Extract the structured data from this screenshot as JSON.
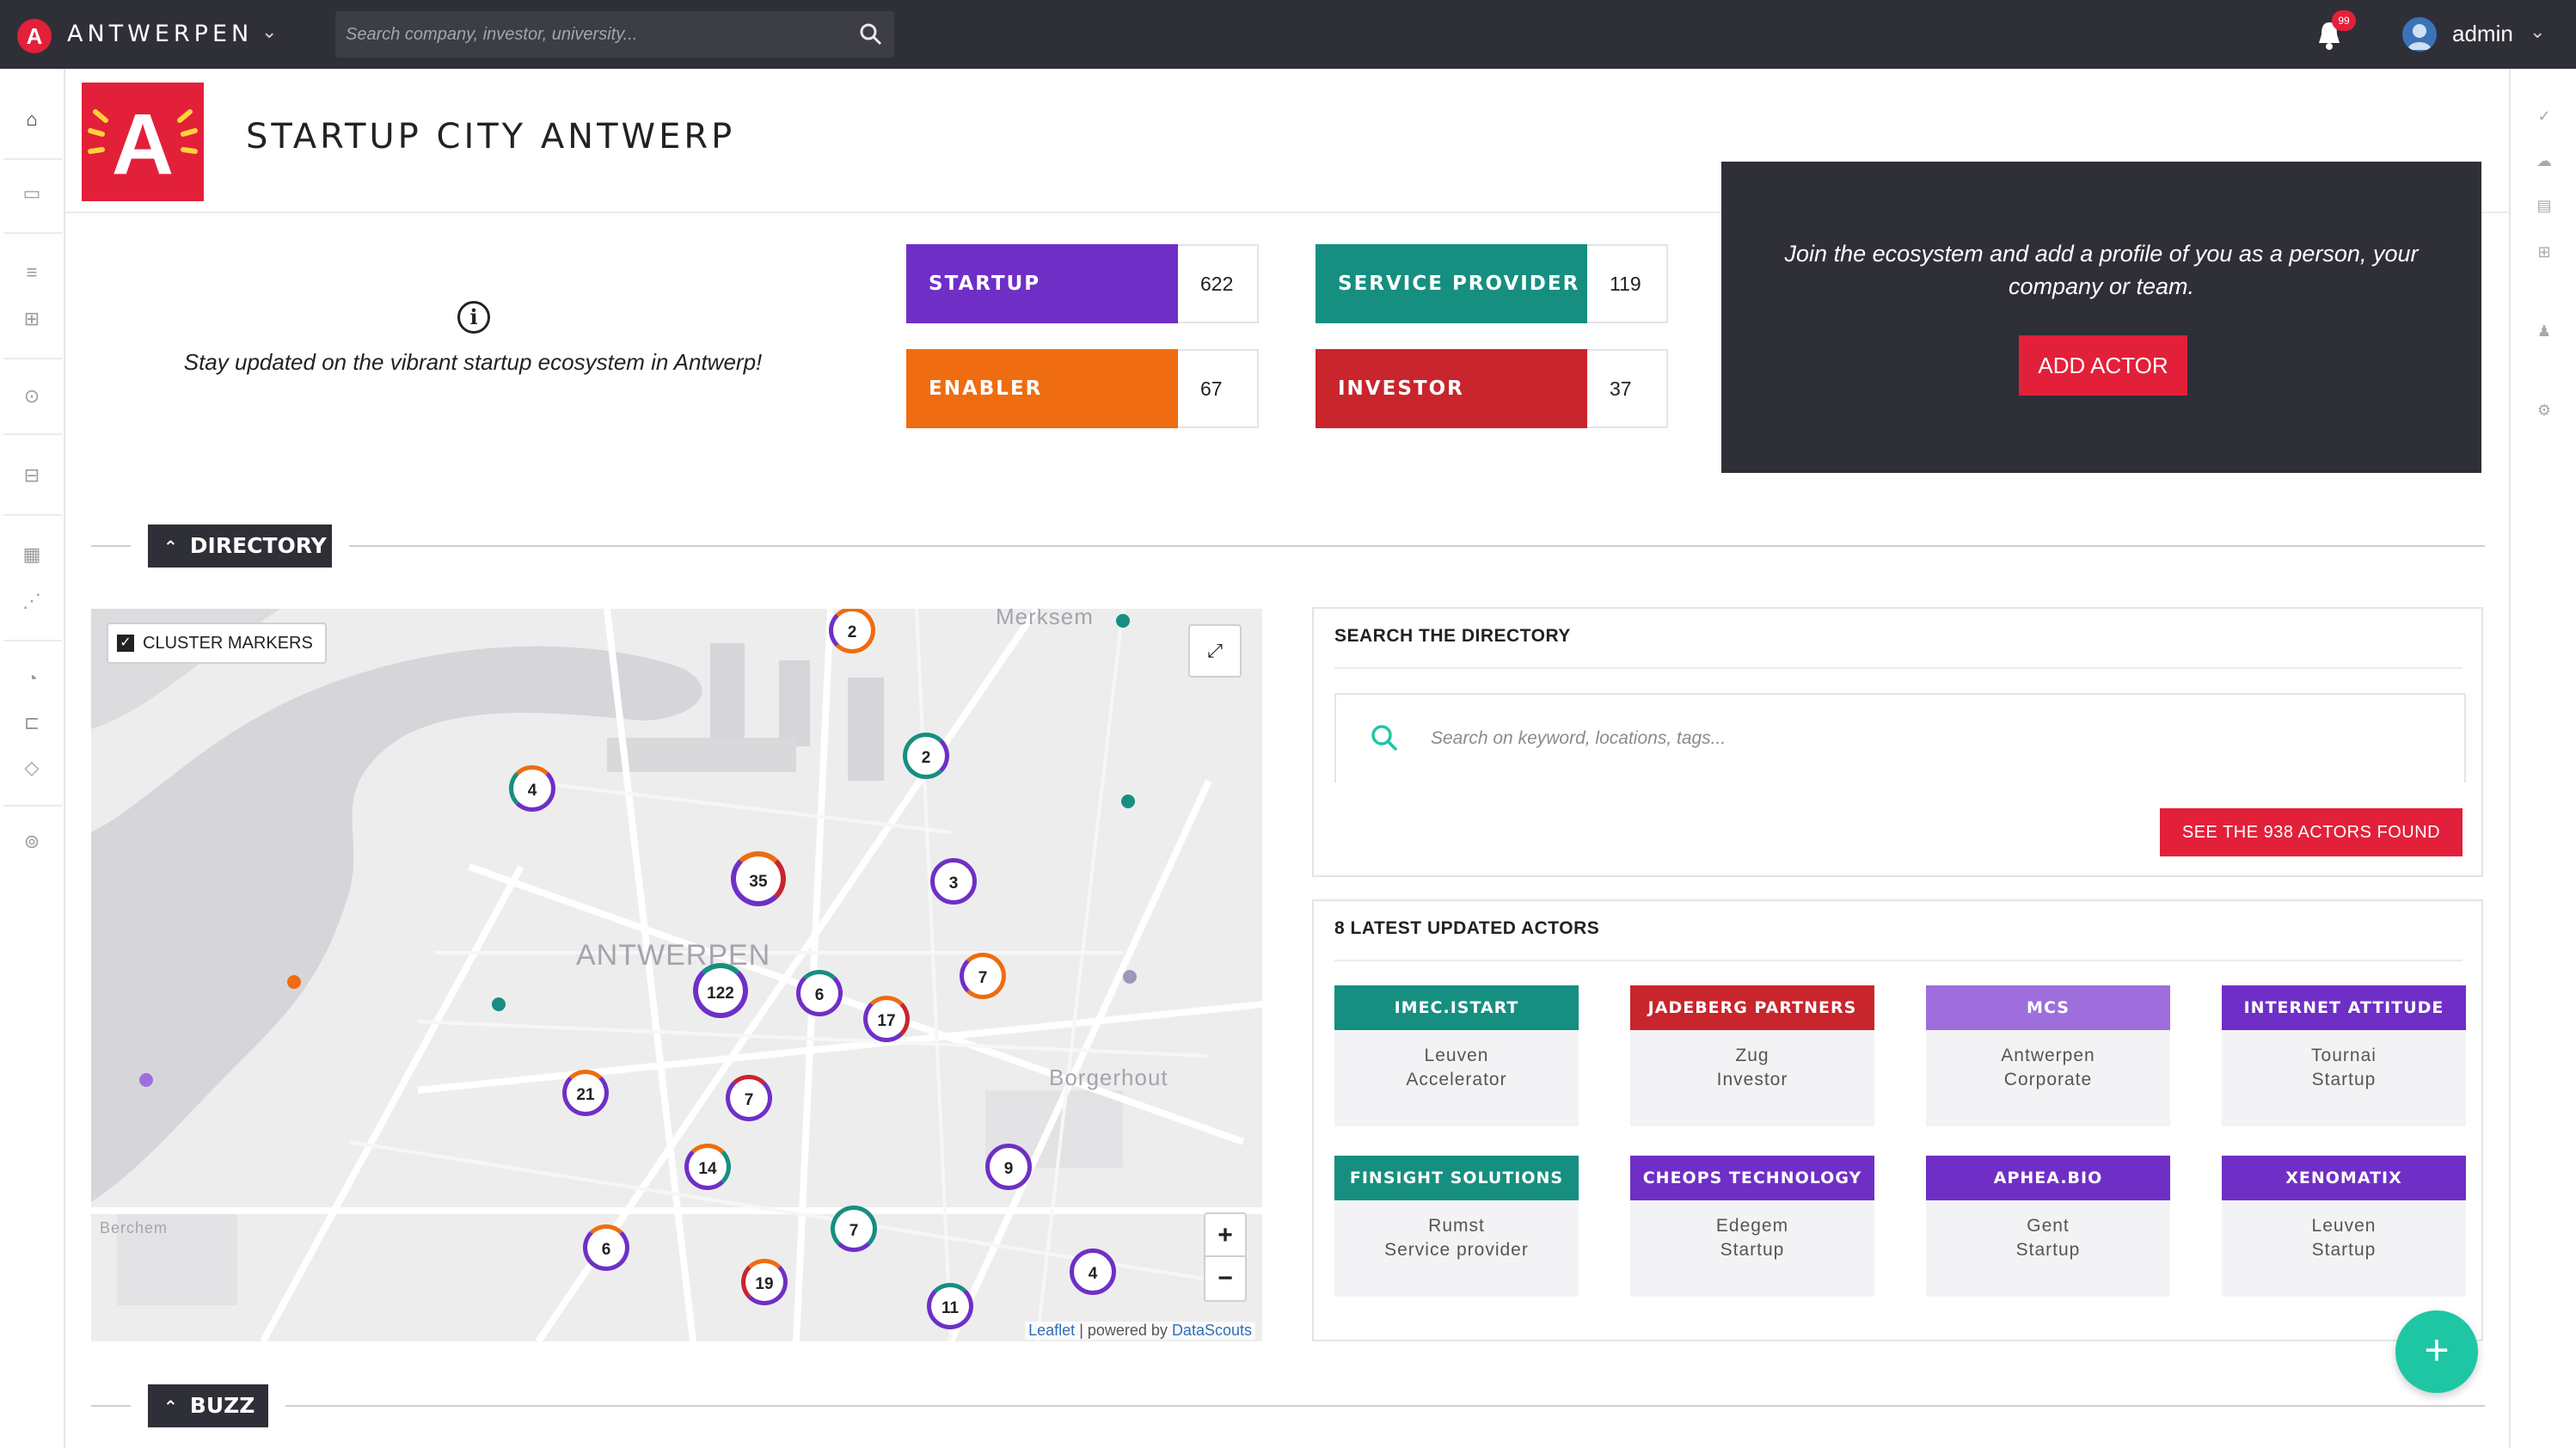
{
  "topbar": {
    "brand": "ANTWERPEN",
    "search_placeholder": "Search company, investor, university...",
    "notification_badge": "99",
    "user_name": "admin"
  },
  "page": {
    "title": "STARTUP CITY ANTWERP",
    "intro": "Stay updated on the vibrant startup ecosystem in Antwerp!"
  },
  "stats": [
    {
      "label": "STARTUP",
      "count": "622",
      "color": "#6f2fc6"
    },
    {
      "label": "SERVICE PROVIDER",
      "count": "119",
      "color": "#168f80"
    },
    {
      "label": "ENABLER",
      "count": "67",
      "color": "#ef6c10"
    },
    {
      "label": "INVESTOR",
      "count": "37",
      "color": "#c8252d"
    }
  ],
  "cta": {
    "text": "Join the ecosystem and add a profile of you as a person, your company or team.",
    "button": "ADD ACTOR"
  },
  "sections": {
    "directory": "DIRECTORY",
    "buzz": "BUZZ"
  },
  "map": {
    "cluster_toggle": "CLUSTER MARKERS",
    "labels": [
      "Merksem",
      "ANTWERPEN",
      "Borgerhout",
      "Berchem"
    ],
    "clusters": [
      "2",
      "2",
      "4",
      "35",
      "3",
      "7",
      "122",
      "6",
      "17",
      "21",
      "7",
      "14",
      "9",
      "7",
      "6",
      "19",
      "11",
      "4"
    ],
    "attrib_leaflet": "Leaflet",
    "attrib_text": " | powered by ",
    "attrib_ds": "DataScouts",
    "zoom_in": "+",
    "zoom_out": "−"
  },
  "directory_search": {
    "title": "SEARCH THE DIRECTORY",
    "placeholder": "Search on keyword, locations, tags...",
    "button": "SEE THE 938 ACTORS FOUND"
  },
  "latest": {
    "title": "8 LATEST UPDATED ACTORS",
    "actors": [
      {
        "name": "IMEC.ISTART",
        "line1": "Leuven",
        "line2": "Accelerator",
        "color": "#168f80"
      },
      {
        "name": "JADEBERG PARTNERS",
        "line1": "Zug",
        "line2": "Investor",
        "color": "#c8252d"
      },
      {
        "name": "MCS",
        "line1": "Antwerpen",
        "line2": "Corporate",
        "color": "#9e6fdc"
      },
      {
        "name": "INTERNET ATTITUDE",
        "line1": "Tournai",
        "line2": "Startup",
        "color": "#6f2fc6"
      },
      {
        "name": "FINSIGHT SOLUTIONS",
        "line1": "Rumst",
        "line2": "Service provider",
        "color": "#168f80"
      },
      {
        "name": "CHEOPS TECHNOLOGY",
        "line1": "Edegem",
        "line2": "Startup",
        "color": "#6f2fc6"
      },
      {
        "name": "APHEA.BIO",
        "line1": "Gent",
        "line2": "Startup",
        "color": "#6f2fc6"
      },
      {
        "name": "XENOMATIX",
        "line1": "Leuven",
        "line2": "Startup",
        "color": "#6f2fc6"
      }
    ]
  },
  "fab": "+",
  "icons": [
    "antwerp-logo-icon",
    "chevron-down-icon",
    "search-icon",
    "bell-icon",
    "user-avatar-icon",
    "home-icon",
    "info-icon",
    "checkbox-icon",
    "fullscreen-icon",
    "plus-icon",
    "chevron-up-icon"
  ],
  "colors": {
    "accent": "#e3203a",
    "dark": "#2f2f37",
    "teal": "#1fc6a4"
  }
}
